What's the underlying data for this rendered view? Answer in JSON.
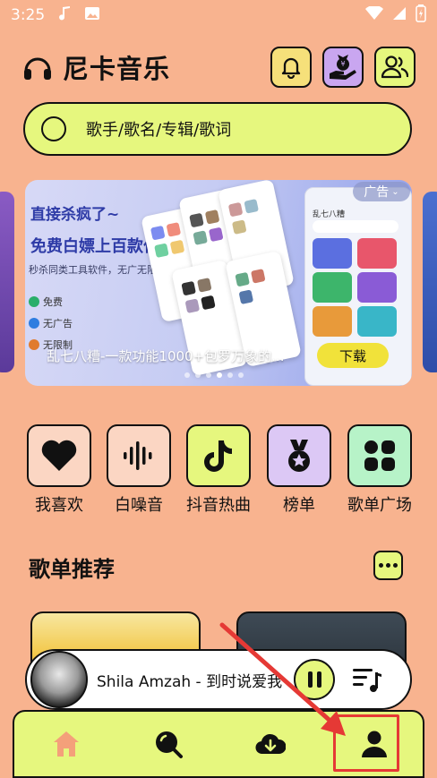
{
  "status": {
    "time": "3:25"
  },
  "header": {
    "app_title": "尼卡音乐"
  },
  "search": {
    "placeholder": "歌手/歌名/专辑/歌词"
  },
  "banner": {
    "headline": "直接杀疯了~",
    "subheadline": "免费白嫖上百款付费功能",
    "small_line": "秒杀同类工具软件，无广无限制",
    "checks": [
      "免费",
      "无广告",
      "无限制"
    ],
    "mock_title": "乱七八糟",
    "ad_tag": "广告",
    "caption": "乱七八糟-一款功能1000+包罗万象的...",
    "download_label": "下载",
    "page_count": 6,
    "active_page": 4
  },
  "quick_actions": [
    {
      "label": "我喜欢",
      "icon": "heart-icon"
    },
    {
      "label": "白噪音",
      "icon": "sound-wave-icon"
    },
    {
      "label": "抖音热曲",
      "icon": "tiktok-icon"
    },
    {
      "label": "榜单",
      "icon": "medal-icon"
    },
    {
      "label": "歌单广场",
      "icon": "grid-icon"
    }
  ],
  "section": {
    "title": "歌单推荐"
  },
  "player": {
    "song": "Shila Amzah - 到时说爱我"
  },
  "tabs": [
    "home-icon",
    "discover-icon",
    "download-icon",
    "profile-icon"
  ],
  "colors": {
    "background": "#F8B38F",
    "accent_lime": "#E6F77E",
    "highlight": "#E53935"
  }
}
